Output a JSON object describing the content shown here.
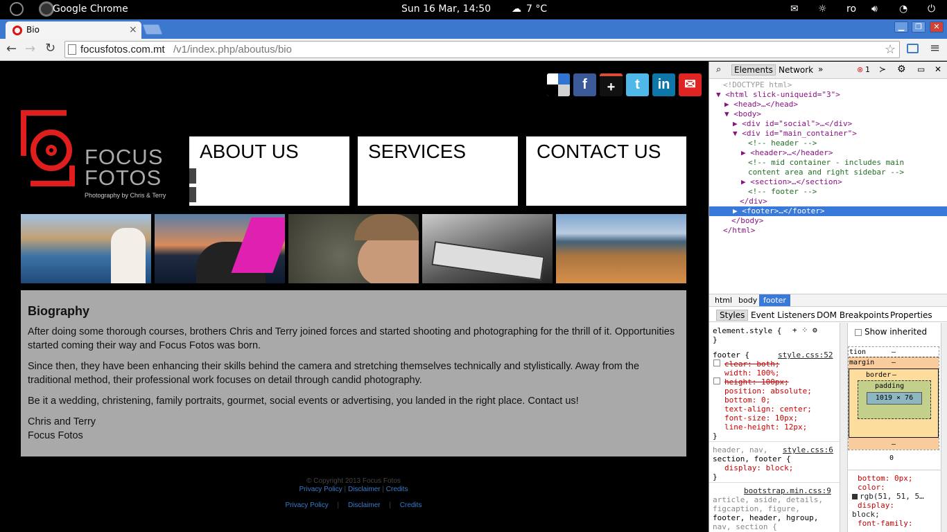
{
  "os": {
    "app": "Google Chrome",
    "datetime": "Sun 16 Mar, 14:50",
    "weather": "7 °C",
    "lang": "ro"
  },
  "tab": {
    "title": "Bio",
    "close": "×"
  },
  "window": {
    "minimize": "▁",
    "restore": "❐",
    "close": "✕"
  },
  "address": {
    "host": "focusfotos.com.mt",
    "path": "/v1/index.php/aboutus/bio"
  },
  "site": {
    "logo_line1": "FOCUS",
    "logo_line2": "FOTOS",
    "logo_tagline": "Photography by Chris & Terry",
    "social": [
      "delicious",
      "facebook",
      "google-plus",
      "twitter",
      "linkedin",
      "email"
    ],
    "nav": [
      "ABOUT US",
      "SERVICES",
      "CONTACT US"
    ],
    "bio_title": "Biography",
    "bio_p1": "After doing some thorough courses, brothers Chris and Terry joined forces and started shooting and photographing for the thrill of it. Opportunities started coming their way and Focus Fotos was born.",
    "bio_p2": "Since then, they have been enhancing their skills behind the camera and stretching themselves technically and stylistically. Away from the traditional method, their professional work focuses on detail through candid photography.",
    "bio_p3": "Be it a wedding, christening, family portraits, gourmet, social events or advertising, you landed in the right place. Contact us!",
    "bio_sign1": "Chris and Terry",
    "bio_sign2": "Focus Fotos",
    "copyright": "© Copyright 2013 Focus Fotos",
    "footer_links": [
      "Privacy Policy",
      "Disclaimer",
      "Credits"
    ]
  },
  "devtools": {
    "tabs": [
      "Elements",
      "Network"
    ],
    "error_count": "1",
    "dom": [
      "<!DOCTYPE html>",
      "<html slick-uniqueid=\"3\">",
      "<head>…</head>",
      "<body>",
      "<div id=\"social\">…</div>",
      "<div id=\"main_container\">",
      "<!-- header -->",
      "<header>…</header>",
      "<!-- mid container - includes main",
      "content area and right sidebar -->",
      "<section>…</section>",
      "<!-- footer -->",
      "</div>",
      "<footer>…</footer>",
      "</body>",
      "</html>"
    ],
    "breadcrumbs": [
      "html",
      "body",
      "footer"
    ],
    "subtabs": [
      "Styles",
      "Event Listeners",
      "DOM Breakpoints",
      "Properties"
    ],
    "element_style": "element.style {",
    "rule1_selector": "footer {",
    "rule1_source": "style.css:52",
    "rule1_props": [
      "clear: both;",
      "width: 100%;",
      "height: 100px;",
      "position: absolute;",
      "bottom: 0;",
      "text-align: center;",
      "font-size: 10px;",
      "line-height: 12px;"
    ],
    "rule2_selector_a": "header, nav,",
    "rule2_selector_b": "section, footer {",
    "rule2_source": "style.css:6",
    "rule2_prop": "display: block;",
    "rule3_source": "bootstrap.min.css:9",
    "rule3_lines": [
      "article, aside, details,",
      "figcaption, figure,",
      "footer, header, hgroup,",
      "nav, section {"
    ],
    "show_inherited": "Show inherited",
    "box_position": "tion",
    "box_margin": "margin",
    "box_border": "border",
    "box_padding": "padding",
    "box_size": "1019 × 76",
    "dash": "–",
    "zero": "0",
    "computed": [
      "bottom: 0px;",
      "color:",
      "rgb(51, 51, 5…",
      "display:",
      "block;",
      "font-family:"
    ]
  }
}
